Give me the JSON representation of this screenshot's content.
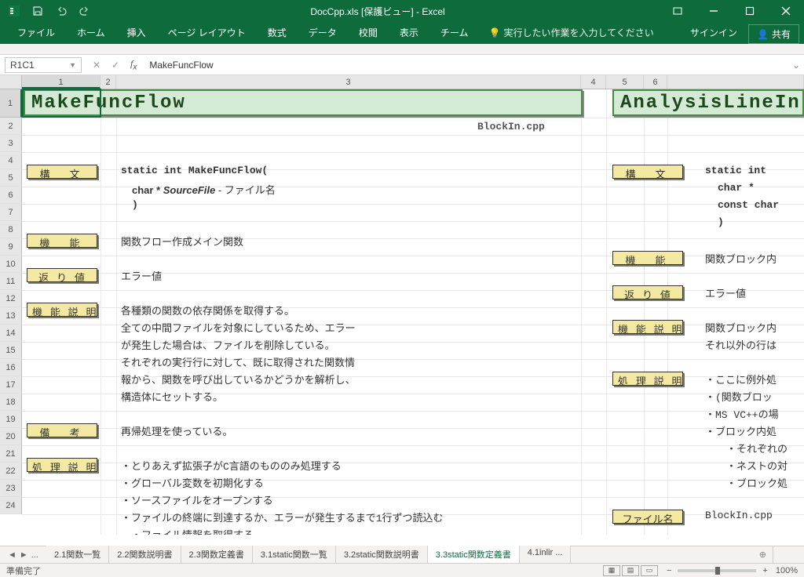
{
  "title": "DocCpp.xls  [保護ビュー]  -  Excel",
  "ribbon": [
    "ファイル",
    "ホーム",
    "挿入",
    "ページ レイアウト",
    "数式",
    "データ",
    "校閲",
    "表示",
    "チーム"
  ],
  "tell_me": "実行したい作業を入力してください",
  "signin": "サインイン",
  "share": "共有",
  "namebox": "R1C1",
  "formula": "MakeFuncFlow",
  "columns": [
    "1",
    "2",
    "3",
    "4",
    "5",
    "6"
  ],
  "rows": [
    "1",
    "2",
    "3",
    "4",
    "5",
    "6",
    "7",
    "8",
    "9",
    "10",
    "11",
    "12",
    "13",
    "14",
    "15",
    "16",
    "17",
    "18",
    "19",
    "20",
    "21",
    "22",
    "23",
    "24"
  ],
  "block1": {
    "title": "MakeFuncFlow",
    "file": "BlockIn.cpp",
    "labels": {
      "kobun": "構　文",
      "kinou": "機　能",
      "kaerichi": "返 り 値",
      "kinousetumei": "機 能 説 明",
      "bikou": "備　考",
      "shorisetumei": "処 理 説 明"
    },
    "kobun": [
      "static int MakeFuncFlow(",
      "  char * SourceFile  - ファイル名",
      "  )"
    ],
    "kinou_text": "関数フロー作成メイン関数",
    "kaerichi_text": "エラー値",
    "kinousetumei_text": [
      "各種類の関数の依存関係を取得する。",
      "全ての中間ファイルを対象にしているため、エラー",
      "が発生した場合は、ファイルを削除している。",
      "それぞれの実行行に対して、既に取得された関数情",
      "報から、関数を呼び出しているかどうかを解析し、",
      "構造体にセットする。"
    ],
    "bikou_text": "再帰処理を使っている。",
    "shorisetumei_text": [
      "・とりあえず拡張子がC言語のもののみ処理する",
      "・グローバル変数を初期化する",
      "・ソースファイルをオープンする",
      "・ファイルの終端に到達するか、エラーが発生するまで1行ずつ読込む",
      "　・ファイル情報を取得する"
    ]
  },
  "block2": {
    "title": "AnalysisLineIn",
    "labels": {
      "kobun": "構　文",
      "kinou": "機　能",
      "kaerichi": "返 り 値",
      "kinousetumei": "機 能 説 明",
      "shorisetumei": "処 理 説 明",
      "filename": "ファイル名"
    },
    "kobun": [
      "static int",
      "  char *",
      "  const char",
      "  )"
    ],
    "kinou_text": "関数ブロック内",
    "kaerichi_text": "エラー値",
    "kinousetumei_text": [
      "関数ブロック内",
      "それ以外の行は"
    ],
    "shorisetumei_text": [
      "・ここに例外処",
      "・(関数ブロッ",
      "・MS VC++の場",
      "・ブロック内処",
      "　・それぞれの",
      "　・ネストの対",
      "　・ブロック処"
    ],
    "filename_text": "BlockIn.cpp"
  },
  "sheet_tabs": [
    "2.1関数一覧",
    "2.2関数説明書",
    "2.3関数定義書",
    "3.1static関数一覧",
    "3.2static関数説明書",
    "3.3static関数定義書",
    "4.1inlir"
  ],
  "active_tab_index": 5,
  "tab_prefix": "...",
  "tab_suffix": "...",
  "status": "準備完了",
  "zoom": "100%"
}
